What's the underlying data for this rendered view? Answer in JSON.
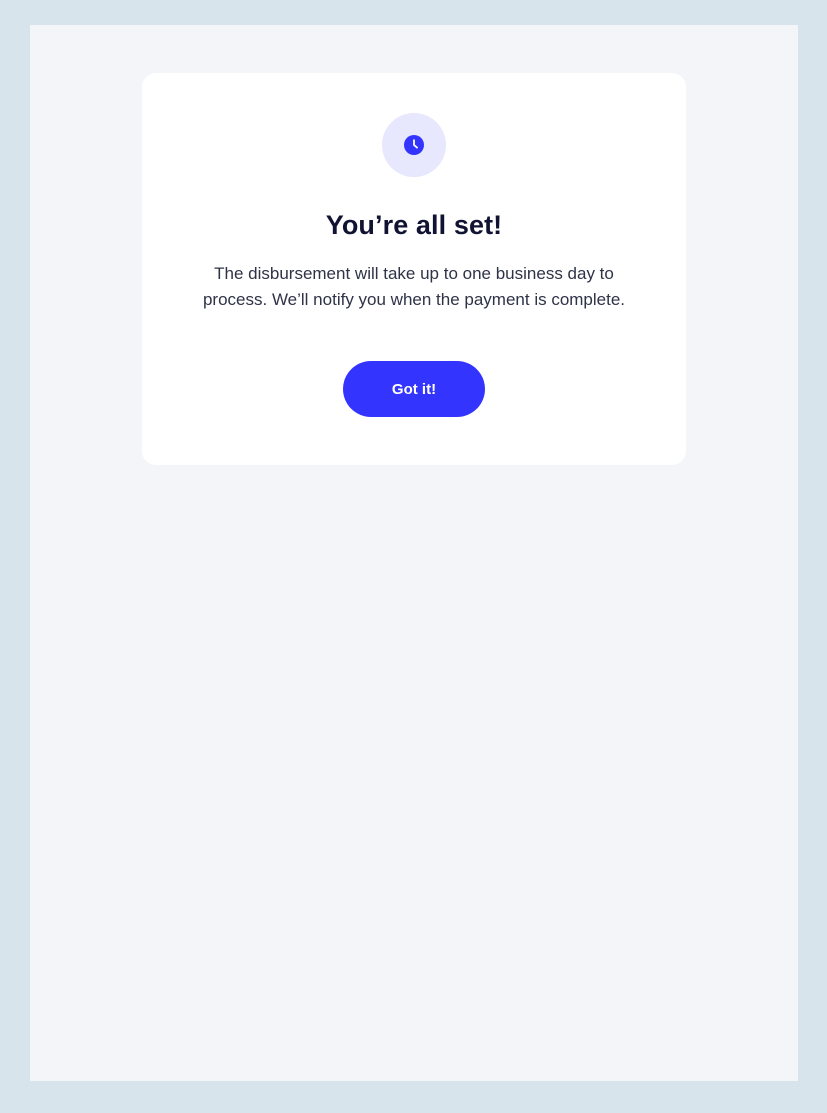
{
  "dialog": {
    "icon": "clock-icon",
    "title": "You’re all set!",
    "message": "The disbursement will take up to one business day to process. We’ll notify you when the payment is complete.",
    "button_label": "Got it!"
  },
  "colors": {
    "page_background": "#d7e4ec",
    "frame_background": "#f3f5f9",
    "card_background": "#ffffff",
    "accent": "#3434ff",
    "icon_circle": "#e7e7fd",
    "title_text": "#111332",
    "body_text": "#2e3347"
  }
}
